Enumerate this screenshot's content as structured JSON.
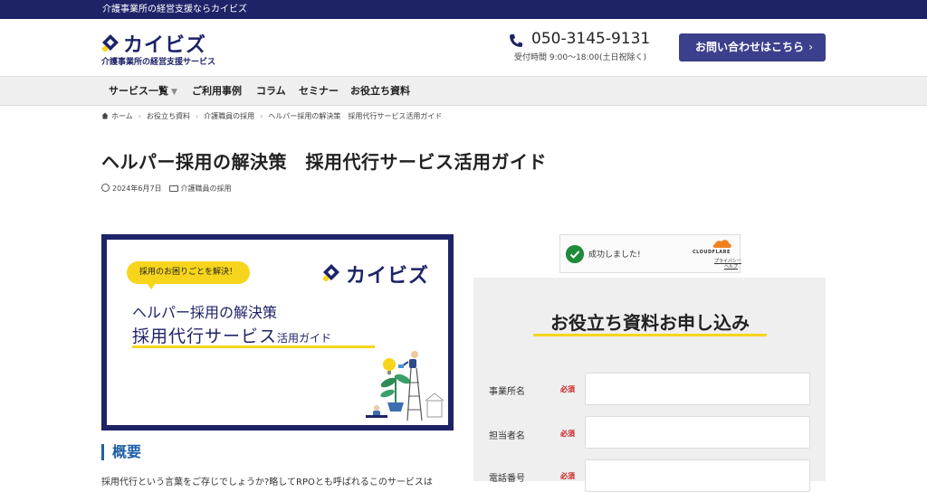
{
  "topbar": {
    "text": "介護事業所の経営支援ならカイビズ"
  },
  "header": {
    "logo_text": "カイビズ",
    "logo_sub": "介護事業所の経営支援サービス",
    "phone": "050-3145-9131",
    "hours": "受付時間 9:00〜18:00(土日祝除く)",
    "contact_label": "お問い合わせはこちら",
    "contact_chevron": "›"
  },
  "nav": {
    "items": [
      {
        "label": "サービス一覧",
        "has_caret": true
      },
      {
        "label": "ご利用事例"
      },
      {
        "label": "コラム"
      },
      {
        "label": "セミナー"
      },
      {
        "label": "お役立ち資料"
      }
    ],
    "caret": "▼"
  },
  "breadcrumb": {
    "items": [
      "ホーム",
      "お役立ち資料",
      "介護職員の採用",
      "ヘルパー採用の解決策　採用代行サービス活用ガイド"
    ],
    "separator": "›"
  },
  "article": {
    "title": "ヘルパー採用の解決策　採用代行サービス活用ガイド",
    "date": "2024年6月7日",
    "category": "介護職員の採用",
    "section_heading": "概要",
    "body_text": "採用代行という言葉をご存じでしょうか?略してRPOとも呼ばれるこのサービスは"
  },
  "hero": {
    "bubble": "採用のお困りごとを解決！",
    "logo_text": "カイビズ",
    "line1": "ヘルパー採用の解決策",
    "line2_main": "採用代行サービス",
    "line2_small": "活用ガイド"
  },
  "captcha": {
    "status": "成功しました!",
    "provider": "CLOUDFLARE",
    "privacy": "プライバシー",
    "help": "ヘルプ"
  },
  "form": {
    "title": "お役立ち資料お申し込み",
    "required_label": "必須",
    "fields": [
      {
        "label": "事業所名",
        "value": ""
      },
      {
        "label": "担当者名",
        "value": ""
      },
      {
        "label": "電話番号",
        "value": ""
      }
    ]
  },
  "colors": {
    "brand_navy": "#1e2368",
    "accent_yellow": "#f7d51d",
    "button_blue": "#3b3f8c",
    "required_red": "#c82020",
    "heading_blue": "#1e5fa8"
  }
}
